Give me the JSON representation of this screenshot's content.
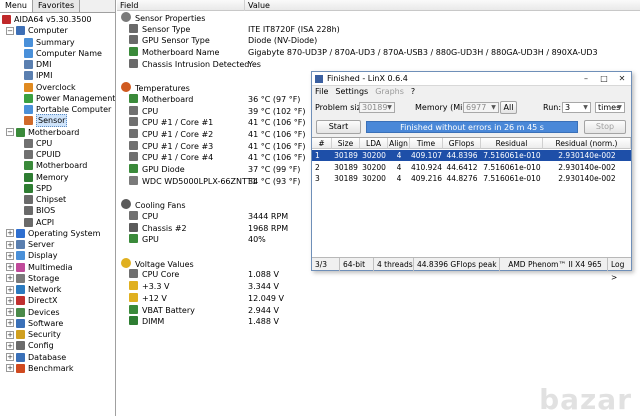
{
  "tabs": [
    "Menu",
    "Favorites"
  ],
  "tree": [
    {
      "label": "AIDA64 v5.30.3500",
      "x": 2,
      "exp": "",
      "icon": "#c0282a",
      "icon_name": "aida64-icon"
    },
    {
      "label": "Computer",
      "x": 6,
      "exp": "−",
      "icon": "#3d6fb6",
      "icon_name": "computer-icon"
    },
    {
      "label": "Summary",
      "x": 24,
      "exp": "",
      "icon": "#4a90d9",
      "icon_name": "summary-icon"
    },
    {
      "label": "Computer Name",
      "x": 24,
      "exp": "",
      "icon": "#4a90d9",
      "icon_name": "computer-name-icon"
    },
    {
      "label": "DMI",
      "x": 24,
      "exp": "",
      "icon": "#5a7fb0",
      "icon_name": "dmi-icon"
    },
    {
      "label": "IPMI",
      "x": 24,
      "exp": "",
      "icon": "#5a7fb0",
      "icon_name": "ipmi-icon"
    },
    {
      "label": "Overclock",
      "x": 24,
      "exp": "",
      "icon": "#e08a20",
      "icon_name": "overclock-icon"
    },
    {
      "label": "Power Management",
      "x": 24,
      "exp": "",
      "icon": "#3aa040",
      "icon_name": "power-icon"
    },
    {
      "label": "Portable Computer",
      "x": 24,
      "exp": "",
      "icon": "#4a90d9",
      "icon_name": "portable-computer-icon"
    },
    {
      "label": "Sensor",
      "x": 24,
      "exp": "",
      "icon": "#d06a2a",
      "icon_name": "sensor-icon",
      "sel": true
    },
    {
      "label": "Motherboard",
      "x": 6,
      "exp": "−",
      "icon": "#3a8a3a",
      "icon_name": "motherboard-icon"
    },
    {
      "label": "CPU",
      "x": 24,
      "exp": "",
      "icon": "#707070",
      "icon_name": "cpu-icon"
    },
    {
      "label": "CPUID",
      "x": 24,
      "exp": "",
      "icon": "#707070",
      "icon_name": "cpuid-icon"
    },
    {
      "label": "Motherboard",
      "x": 24,
      "exp": "",
      "icon": "#3a8a3a",
      "icon_name": "motherboard-icon"
    },
    {
      "label": "Memory",
      "x": 24,
      "exp": "",
      "icon": "#2e7d32",
      "icon_name": "memory-icon"
    },
    {
      "label": "SPD",
      "x": 24,
      "exp": "",
      "icon": "#2e7d32",
      "icon_name": "spd-icon"
    },
    {
      "label": "Chipset",
      "x": 24,
      "exp": "",
      "icon": "#6a6a6a",
      "icon_name": "chipset-icon"
    },
    {
      "label": "BIOS",
      "x": 24,
      "exp": "",
      "icon": "#6a6a6a",
      "icon_name": "bios-icon"
    },
    {
      "label": "ACPI",
      "x": 24,
      "exp": "",
      "icon": "#6a6a6a",
      "icon_name": "acpi-icon"
    },
    {
      "label": "Operating System",
      "x": 6,
      "exp": "+",
      "icon": "#2f6fd0",
      "icon_name": "windows-icon"
    },
    {
      "label": "Server",
      "x": 6,
      "exp": "+",
      "icon": "#5a7fb0",
      "icon_name": "server-icon"
    },
    {
      "label": "Display",
      "x": 6,
      "exp": "+",
      "icon": "#4a90d9",
      "icon_name": "display-icon"
    },
    {
      "label": "Multimedia",
      "x": 6,
      "exp": "+",
      "icon": "#c04a9a",
      "icon_name": "multimedia-icon"
    },
    {
      "label": "Storage",
      "x": 6,
      "exp": "+",
      "icon": "#7a7a7a",
      "icon_name": "storage-icon"
    },
    {
      "label": "Network",
      "x": 6,
      "exp": "+",
      "icon": "#2a7ac0",
      "icon_name": "network-icon"
    },
    {
      "label": "DirectX",
      "x": 6,
      "exp": "+",
      "icon": "#c03030",
      "icon_name": "directx-icon"
    },
    {
      "label": "Devices",
      "x": 6,
      "exp": "+",
      "icon": "#4a8a4a",
      "icon_name": "devices-icon"
    },
    {
      "label": "Software",
      "x": 6,
      "exp": "+",
      "icon": "#3a70b8",
      "icon_name": "software-icon"
    },
    {
      "label": "Security",
      "x": 6,
      "exp": "+",
      "icon": "#d0a020",
      "icon_name": "security-icon"
    },
    {
      "label": "Config",
      "x": 6,
      "exp": "+",
      "icon": "#6a6a6a",
      "icon_name": "config-icon"
    },
    {
      "label": "Database",
      "x": 6,
      "exp": "+",
      "icon": "#3a70b8",
      "icon_name": "database-icon"
    },
    {
      "label": "Benchmark",
      "x": 6,
      "exp": "+",
      "icon": "#d04a20",
      "icon_name": "benchmark-icon"
    }
  ],
  "columns": {
    "field": "Field",
    "value": "Value"
  },
  "rows": [
    {
      "type": "grp",
      "label": "Sensor Properties",
      "icon": "#7a7a7a",
      "icon_name": "sensor-group-icon"
    },
    {
      "label": "Sensor Type",
      "value": "ITE IT8720F  (ISA 228h)",
      "icon": "#6a6a6a",
      "icon_name": "sensor-icon"
    },
    {
      "label": "GPU Sensor Type",
      "value": "Diode  (NV-Diode)",
      "icon": "#6a6a6a",
      "icon_name": "gpu-sensor-icon"
    },
    {
      "label": "Motherboard Name",
      "value": "Gigabyte 870-UD3P / 870A-UD3 / 870A-USB3 / 880G-UD3H / 880GA-UD3H / 890XA-UD3",
      "icon": "#3a8a3a",
      "icon_name": "motherboard-icon"
    },
    {
      "label": "Chassis Intrusion Detected",
      "value": "Yes",
      "icon": "#6a6a6a",
      "icon_name": "chassis-icon"
    },
    {
      "type": "gap"
    },
    {
      "type": "grp",
      "label": "Temperatures",
      "icon": "#d05a20",
      "icon_name": "thermometer-icon"
    },
    {
      "label": "Motherboard",
      "value": "36 °C  (97 °F)",
      "icon": "#3a8a3a",
      "icon_name": "motherboard-icon"
    },
    {
      "label": "CPU",
      "value": "39 °C  (102 °F)",
      "icon": "#707070",
      "icon_name": "cpu-icon"
    },
    {
      "label": "CPU #1 / Core #1",
      "value": "41 °C  (106 °F)",
      "icon": "#707070",
      "icon_name": "cpu-icon"
    },
    {
      "label": "CPU #1 / Core #2",
      "value": "41 °C  (106 °F)",
      "icon": "#707070",
      "icon_name": "cpu-icon"
    },
    {
      "label": "CPU #1 / Core #3",
      "value": "41 °C  (106 °F)",
      "icon": "#707070",
      "icon_name": "cpu-icon"
    },
    {
      "label": "CPU #1 / Core #4",
      "value": "41 °C  (106 °F)",
      "icon": "#707070",
      "icon_name": "cpu-icon"
    },
    {
      "label": "GPU Diode",
      "value": "37 °C  (99 °F)",
      "icon": "#3a8a3a",
      "icon_name": "gpu-icon"
    },
    {
      "label": "WDC WD5000LPLX-66ZNTT1",
      "value": "34 °C  (93 °F)",
      "icon": "#7a7a7a",
      "icon_name": "hdd-icon"
    },
    {
      "type": "gap"
    },
    {
      "type": "grp",
      "label": "Cooling Fans",
      "icon": "#5a5a5a",
      "icon_name": "fan-icon"
    },
    {
      "label": "CPU",
      "value": "3444 RPM",
      "icon": "#707070",
      "icon_name": "cpu-icon"
    },
    {
      "label": "Chassis #2",
      "value": "1968 RPM",
      "icon": "#5a5a5a",
      "icon_name": "fan-icon"
    },
    {
      "label": "GPU",
      "value": "40%",
      "icon": "#3a8a3a",
      "icon_name": "gpu-icon"
    },
    {
      "type": "gap"
    },
    {
      "type": "grp",
      "label": "Voltage Values",
      "icon": "#e0b020",
      "icon_name": "voltage-icon"
    },
    {
      "label": "CPU Core",
      "value": "1.088 V",
      "icon": "#707070",
      "icon_name": "cpu-icon"
    },
    {
      "label": "+3.3 V",
      "value": "3.344 V",
      "icon": "#e0b020",
      "icon_name": "voltage-icon"
    },
    {
      "label": "+12 V",
      "value": "12.049 V",
      "icon": "#e0b020",
      "icon_name": "voltage-icon"
    },
    {
      "label": "VBAT Battery",
      "value": "2.944 V",
      "icon": "#3a8a3a",
      "icon_name": "battery-icon"
    },
    {
      "label": "DIMM",
      "value": "1.488 V",
      "icon": "#2e7d32",
      "icon_name": "memory-icon"
    }
  ],
  "linx": {
    "title": "Finished - LinX 0.6.4",
    "menu": [
      "File",
      "Settings",
      "Graphs",
      "?"
    ],
    "problem_size_label": "Problem size:",
    "problem_size": "30189",
    "memory_label": "Memory (MiB):",
    "memory": "6977",
    "all_label": "All",
    "run_label": "Run:",
    "run_value": "3",
    "run_unit": "times",
    "start_label": "Start",
    "stop_label": "Stop",
    "status": "Finished without errors in 26 m 45 s",
    "headers": [
      "#",
      "Size",
      "LDA",
      "Align",
      "Time",
      "GFlops",
      "Residual",
      "Residual (norm.)"
    ],
    "results": [
      [
        "1",
        "30189",
        "30200",
        "4",
        "409.107",
        "44.8396",
        "7.516061e-010",
        "2.930140e-002"
      ],
      [
        "2",
        "30189",
        "30200",
        "4",
        "410.924",
        "44.6412",
        "7.516061e-010",
        "2.930140e-002"
      ],
      [
        "3",
        "30189",
        "30200",
        "4",
        "409.216",
        "44.8276",
        "7.516061e-010",
        "2.930140e-002"
      ]
    ],
    "statusbar": [
      "3/3",
      "64-bit",
      "4 threads",
      "44.8396 GFlops peak",
      "AMD Phenom™ II X4 965",
      "Log >"
    ]
  },
  "watermark": "bazar"
}
